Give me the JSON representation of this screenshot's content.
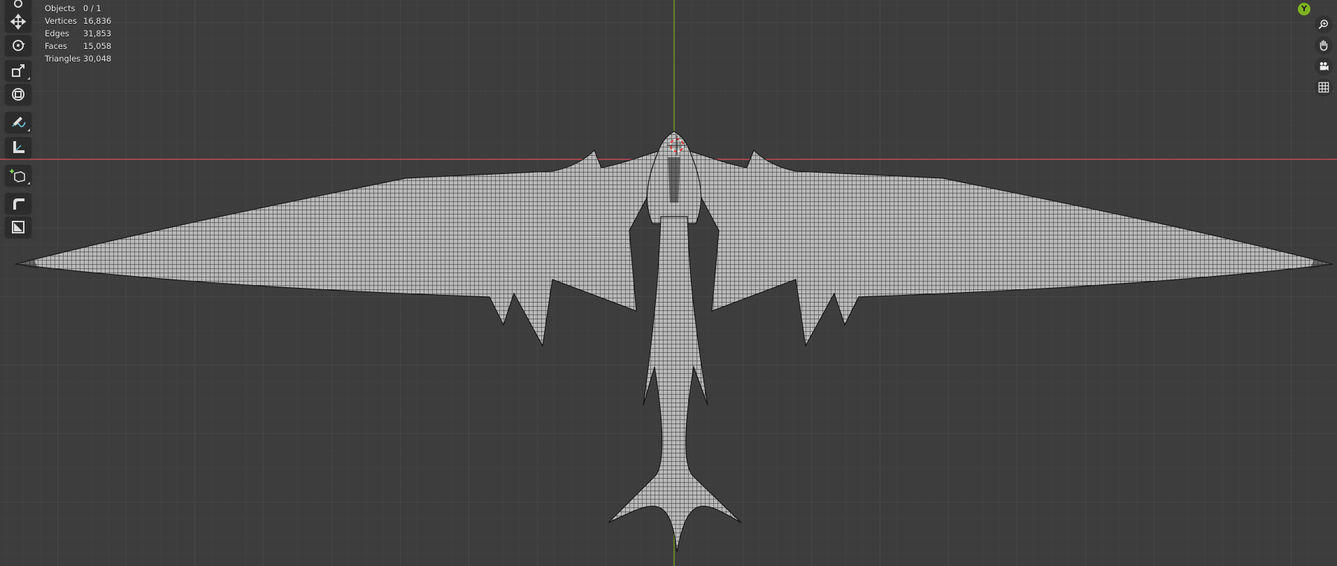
{
  "stats": {
    "objects_label": "Objects",
    "objects_value": "0 / 1",
    "vertices_label": "Vertices",
    "vertices_value": "16,836",
    "edges_label": "Edges",
    "edges_value": "31,853",
    "faces_label": "Faces",
    "faces_value": "15,058",
    "triangles_label": "Triangles",
    "triangles_value": "30,048"
  },
  "toolbar": {
    "tools": [
      "select-tool",
      "move-tool",
      "rotate-tool",
      "scale-tool",
      "transform-tool",
      "annotate-tool",
      "measure-tool",
      "add-cube-tool",
      "bevel-tool",
      "inset-tool"
    ]
  },
  "navigation": {
    "axis_label": "Y",
    "buttons": [
      "zoom-icon",
      "pan-hand-icon",
      "camera-icon",
      "grid-icon"
    ]
  },
  "colors": {
    "background": "#3d3d3d",
    "x_axis": "#d44a5a",
    "y_axis": "#7fb320",
    "mesh_fill": "#b7b7b7",
    "wire": "#1a1a1a",
    "cursor": "#e03030"
  }
}
